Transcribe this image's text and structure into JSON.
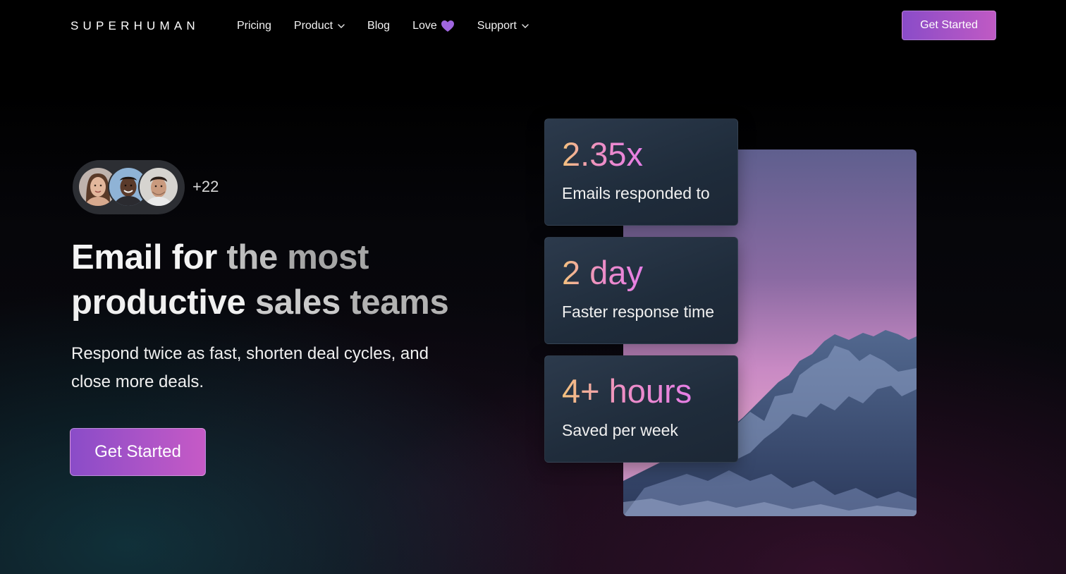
{
  "nav": {
    "logo": "SUPERHUMAN",
    "links": [
      {
        "label": "Pricing",
        "has_dropdown": false
      },
      {
        "label": "Product",
        "has_dropdown": true
      },
      {
        "label": "Blog",
        "has_dropdown": false
      },
      {
        "label": "Love",
        "has_dropdown": false,
        "icon": "purple-heart-icon"
      },
      {
        "label": "Support",
        "has_dropdown": true
      }
    ],
    "cta_label": "Get Started"
  },
  "hero": {
    "avatar_count": "+22",
    "headline": {
      "words": [
        "Email",
        "for",
        "the",
        "most",
        "productive",
        "sales",
        "teams"
      ]
    },
    "subhead": "Respond twice as fast, shorten deal cycles, and close more deals.",
    "cta_label": "Get Started"
  },
  "stats": [
    {
      "value": "2.35x",
      "label": "Emails responded to"
    },
    {
      "value": "2 day",
      "label": "Faster response time"
    },
    {
      "value": "4+ hours",
      "label": "Saved per week"
    }
  ],
  "colors": {
    "accent_gradient_start": "#8a4cc8",
    "accent_gradient_end": "#c65ac6",
    "stat_gradient": [
      "#f4c27c",
      "#ee8fc4",
      "#e67ee6"
    ],
    "heart": "#a066e0"
  }
}
